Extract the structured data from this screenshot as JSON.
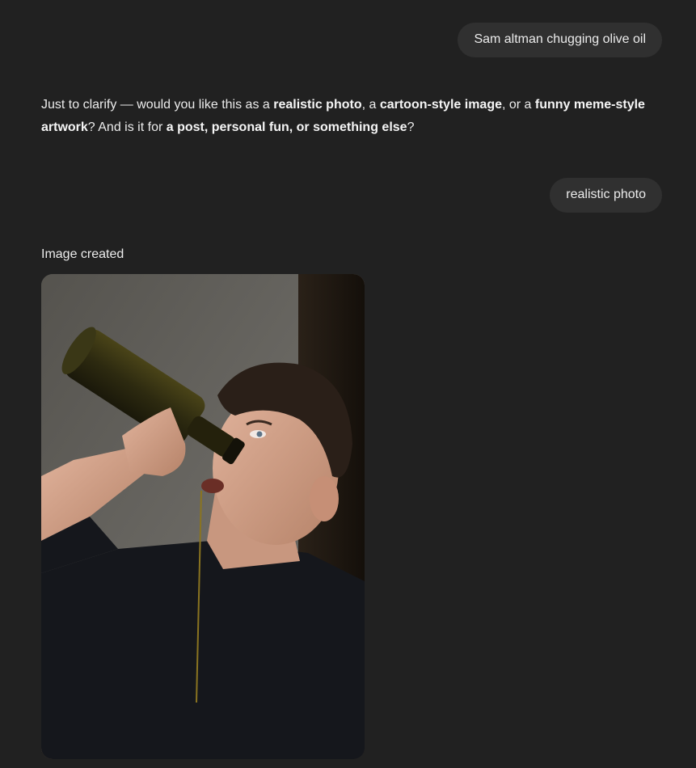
{
  "conversation": {
    "user_message_1": "Sam altman chugging olive oil",
    "assistant_message": {
      "p1": "Just to clarify — would you like this as a ",
      "b1": "realistic photo",
      "p2": ", a ",
      "b2": "cartoon-style image",
      "p3": ", or a ",
      "b3": "funny meme-style artwork",
      "p4": "? And is it for ",
      "b4": "a post, personal fun, or something else",
      "p5": "?"
    },
    "user_message_2": "realistic photo",
    "image_caption": "Image created"
  },
  "colors": {
    "background": "#212121",
    "user_bubble": "#303030",
    "text": "#ececec"
  }
}
